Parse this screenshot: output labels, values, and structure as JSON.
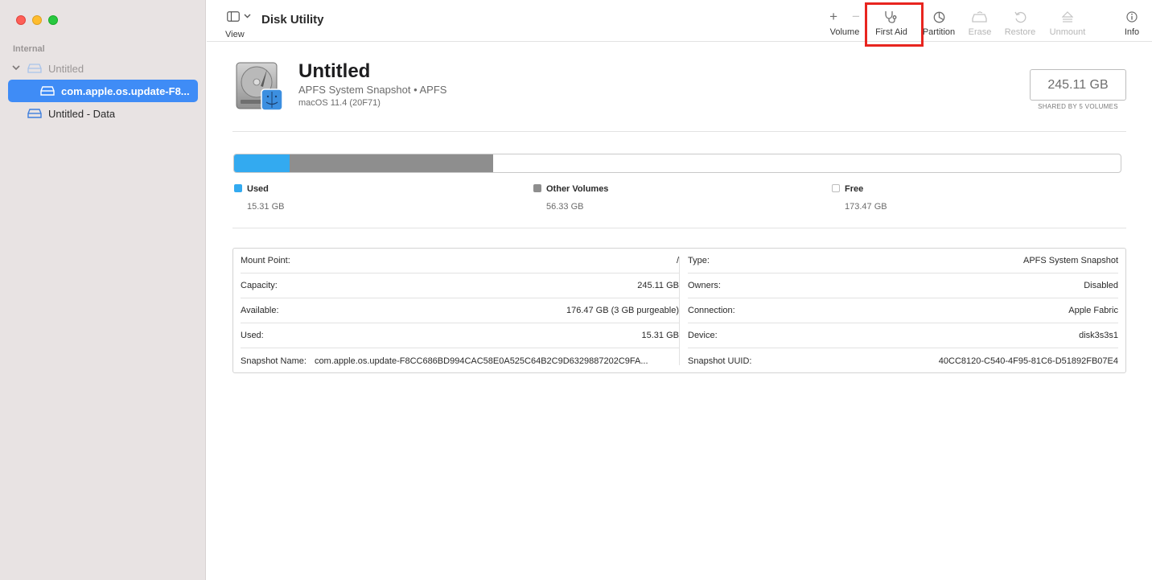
{
  "app": {
    "title": "Disk Utility"
  },
  "sidebar": {
    "section": "Internal",
    "items": [
      {
        "label": "Untitled"
      },
      {
        "label": "com.apple.os.update-F8..."
      },
      {
        "label": "Untitled - Data"
      }
    ]
  },
  "toolbar": {
    "view": "View",
    "volume": "Volume",
    "first_aid": "First Aid",
    "partition": "Partition",
    "erase": "Erase",
    "restore": "Restore",
    "unmount": "Unmount",
    "info": "Info"
  },
  "volume": {
    "name": "Untitled",
    "subtitle": "APFS System Snapshot • APFS",
    "os": "macOS 11.4 (20F71)",
    "capacity": "245.11 GB",
    "shared_note": "SHARED BY 5 VOLUMES"
  },
  "usage": {
    "total_gb": 245.11,
    "used": {
      "label": "Used",
      "value": "15.31 GB",
      "gb": 15.31,
      "color": "#33aaf0"
    },
    "other": {
      "label": "Other Volumes",
      "value": "56.33 GB",
      "gb": 56.33,
      "color": "#8e8e8e"
    },
    "free": {
      "label": "Free",
      "value": "173.47 GB",
      "gb": 173.47,
      "color": "#ffffff"
    }
  },
  "info": {
    "left": [
      {
        "key": "Mount Point:",
        "value": "/"
      },
      {
        "key": "Capacity:",
        "value": "245.11 GB"
      },
      {
        "key": "Available:",
        "value": "176.47 GB (3 GB purgeable)"
      },
      {
        "key": "Used:",
        "value": "15.31 GB"
      },
      {
        "key": "Snapshot Name:",
        "value": "com.apple.os.update-F8CC686BD994CAC58E0A525C64B2C9D6329887202C9FA..."
      }
    ],
    "right": [
      {
        "key": "Type:",
        "value": "APFS System Snapshot"
      },
      {
        "key": "Owners:",
        "value": "Disabled"
      },
      {
        "key": "Connection:",
        "value": "Apple Fabric"
      },
      {
        "key": "Device:",
        "value": "disk3s3s1"
      },
      {
        "key": "Snapshot UUID:",
        "value": "40CC8120-C540-4F95-81C6-D51892FB07E4"
      }
    ]
  }
}
